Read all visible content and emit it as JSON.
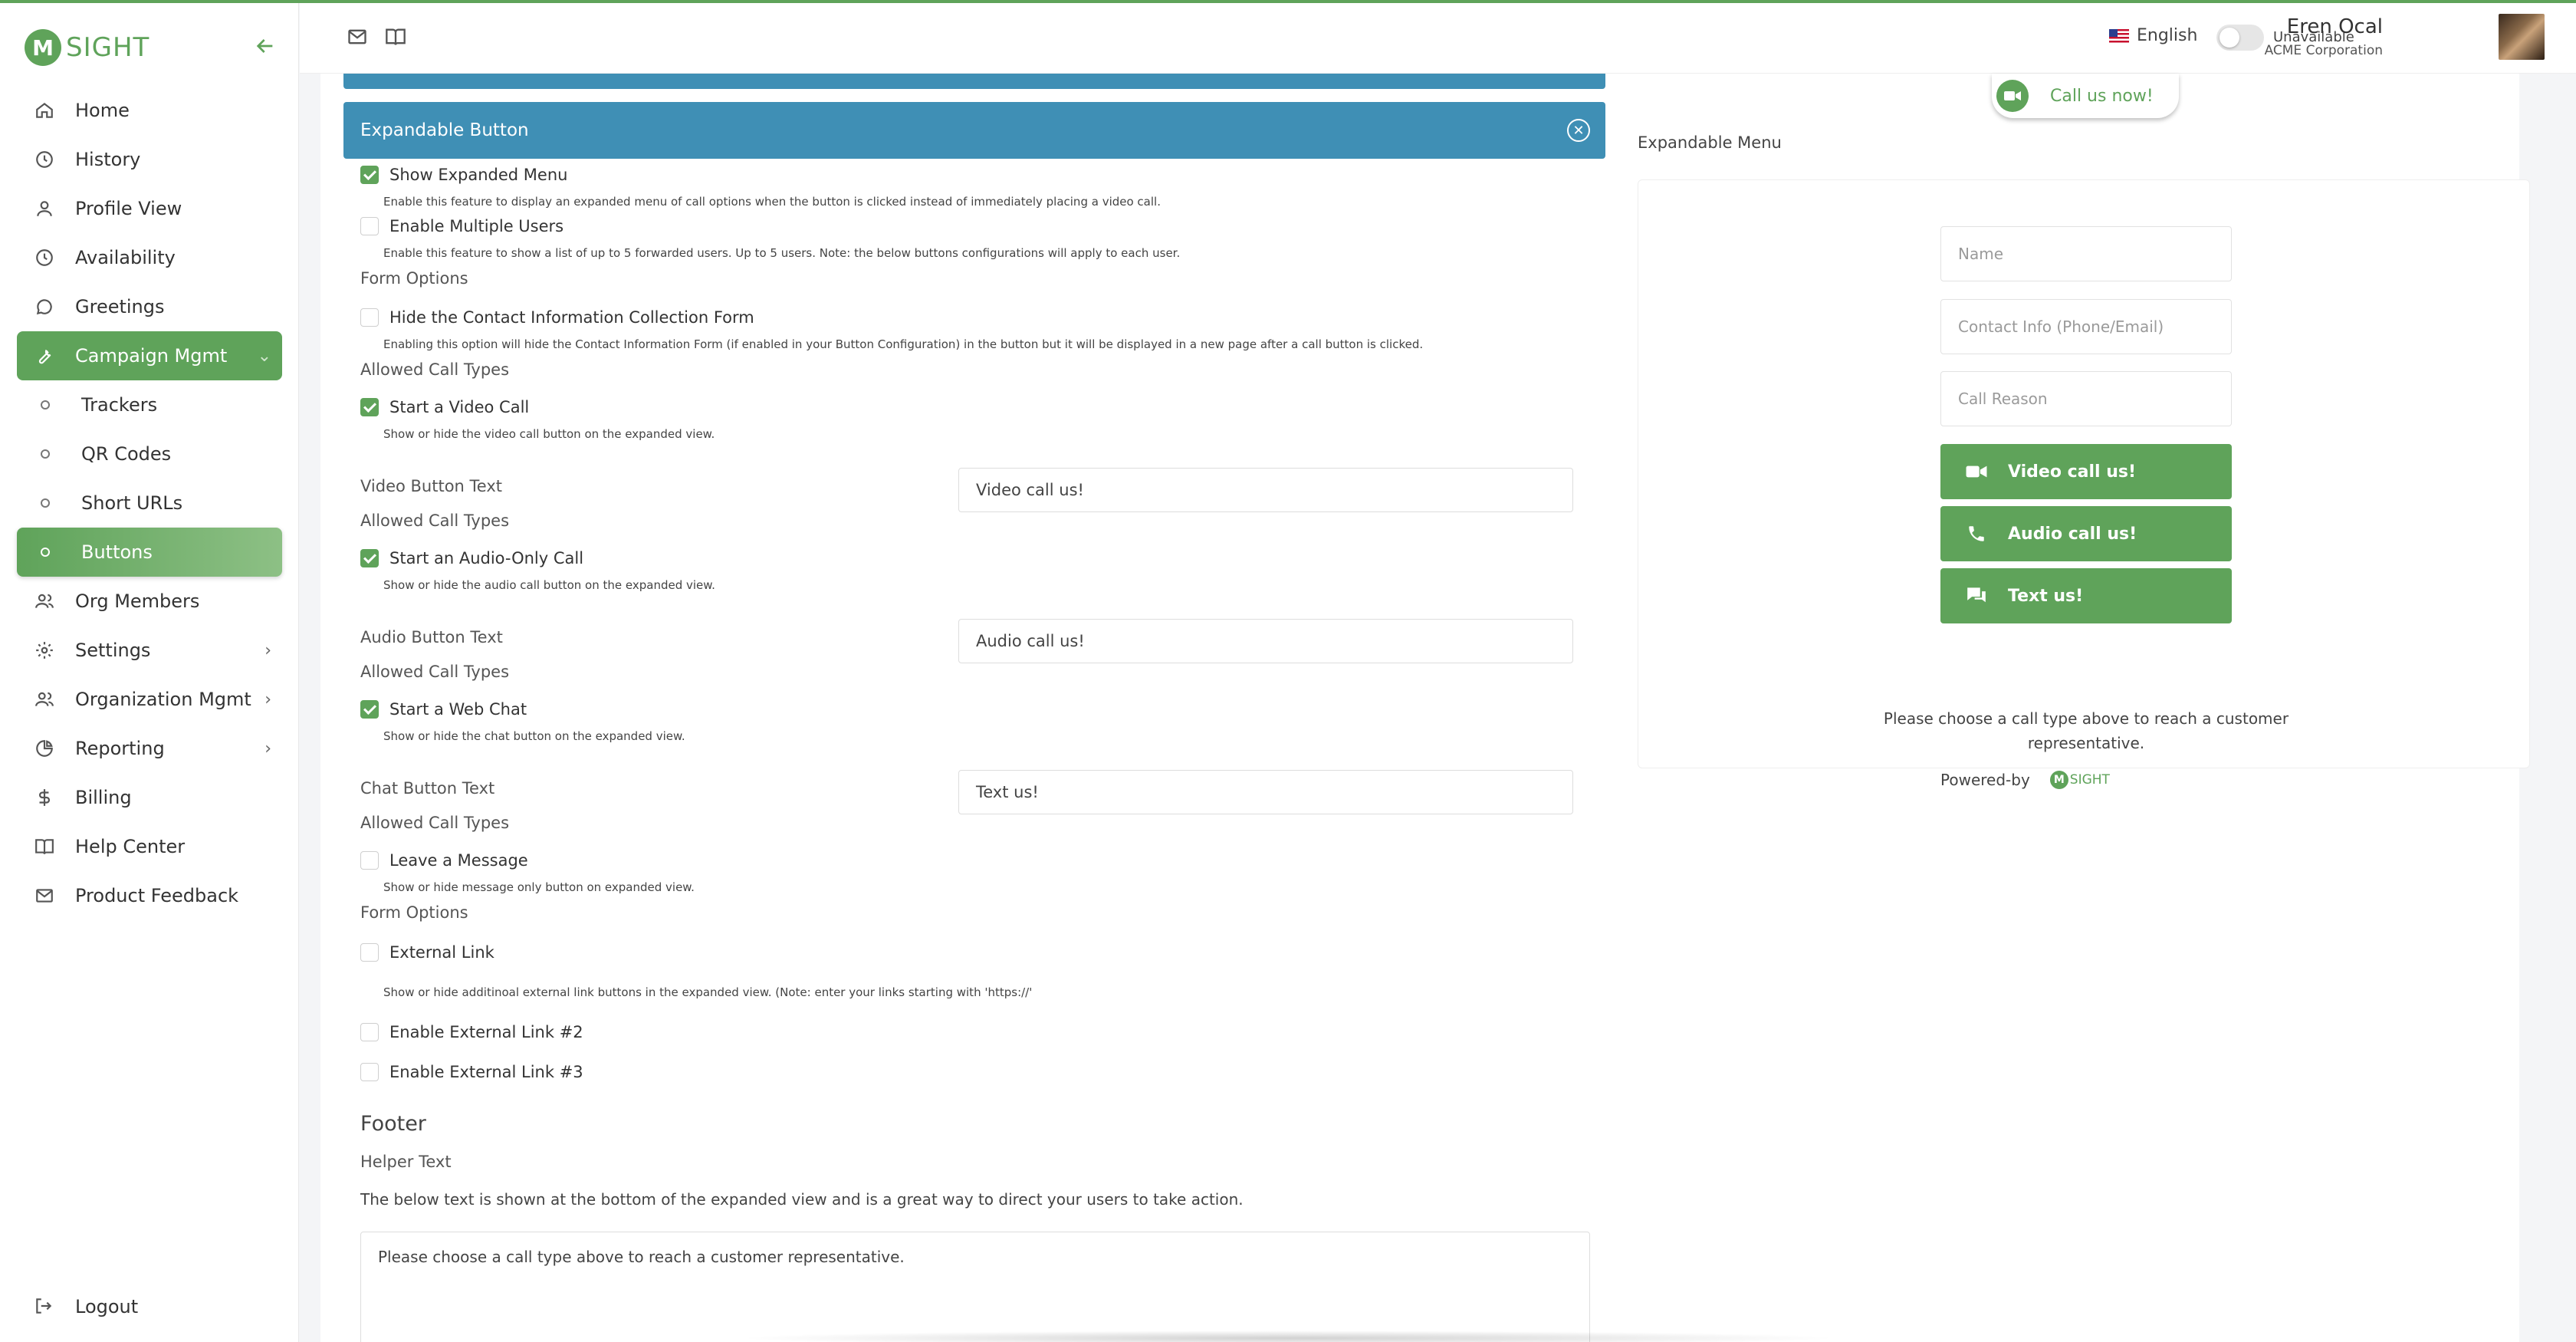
{
  "brand": {
    "logo_letter": "M",
    "logo_text": "SIGHT",
    "accent": "#5fa35a",
    "header_blue": "#3f8fb5"
  },
  "sidebar": {
    "items": [
      {
        "label": "Home",
        "icon": "home-icon"
      },
      {
        "label": "History",
        "icon": "clock-icon"
      },
      {
        "label": "Profile View",
        "icon": "user-icon"
      },
      {
        "label": "Availability",
        "icon": "clock-icon"
      },
      {
        "label": "Greetings",
        "icon": "chat-icon"
      },
      {
        "label": "Campaign Mgmt",
        "icon": "wrench-icon"
      },
      {
        "label": "Trackers",
        "icon": "circle-icon"
      },
      {
        "label": "QR Codes",
        "icon": "circle-icon"
      },
      {
        "label": "Short URLs",
        "icon": "circle-icon"
      },
      {
        "label": "Buttons",
        "icon": "circle-icon"
      },
      {
        "label": "Org Members",
        "icon": "users-icon"
      },
      {
        "label": "Settings",
        "icon": "gear-icon"
      },
      {
        "label": "Organization Mgmt",
        "icon": "users-icon"
      },
      {
        "label": "Reporting",
        "icon": "pie-chart-icon"
      },
      {
        "label": "Billing",
        "icon": "dollar-icon"
      },
      {
        "label": "Help Center",
        "icon": "book-icon"
      },
      {
        "label": "Product Feedback",
        "icon": "mail-icon"
      }
    ],
    "logout": "Logout"
  },
  "topbar": {
    "language": "English",
    "status": "Unavailable",
    "user_name": "Eren Ocal",
    "user_org": "ACME Corporation"
  },
  "form": {
    "panel_title": "Expandable Button",
    "show_expanded_menu": {
      "label": "Show Expanded Menu",
      "checked": true,
      "help": "Enable this feature to display an expanded menu of call options when the button is clicked instead of immediately placing a video call."
    },
    "enable_multiple_users": {
      "label": "Enable Multiple Users",
      "checked": false,
      "help": "Enable this feature to show a list of up to 5 forwarded users. Up to 5 users. Note: the below buttons configurations will apply to each user."
    },
    "form_options_1": "Form Options",
    "hide_contact_form": {
      "label": "Hide the Contact Information Collection Form",
      "checked": false,
      "help": "Enabling this option will hide the Contact Information Form (if enabled in your Button Configuration) in the button but it will be displayed in a new page after a call button is clicked."
    },
    "allowed_call_types_1": "Allowed Call Types",
    "video_call": {
      "label": "Start a Video Call",
      "checked": true,
      "help": "Show or hide the video call button on the expanded view."
    },
    "video_button_text_label": "Video Button Text",
    "video_button_text_value": "Video call us!",
    "allowed_call_types_2": "Allowed Call Types",
    "audio_call": {
      "label": "Start an Audio-Only Call",
      "checked": true,
      "help": "Show or hide the audio call button on the expanded view."
    },
    "audio_button_text_label": "Audio Button Text",
    "audio_button_text_value": "Audio call us!",
    "allowed_call_types_3": "Allowed Call Types",
    "web_chat": {
      "label": "Start a Web Chat",
      "checked": true,
      "help": "Show or hide the chat button on the expanded view."
    },
    "chat_button_text_label": "Chat Button Text",
    "chat_button_text_value": "Text us!",
    "allowed_call_types_4": "Allowed Call Types",
    "leave_message": {
      "label": "Leave a Message",
      "checked": false,
      "help": "Show or hide message only button on expanded view."
    },
    "form_options_2": "Form Options",
    "external_link": {
      "label": "External Link",
      "checked": false,
      "help": "Show or hide additinoal external link buttons in the expanded view. (Note: enter your links starting with 'https://'"
    },
    "external_link_2": {
      "label": "Enable External Link #2",
      "checked": false
    },
    "external_link_3": {
      "label": "Enable External Link #3",
      "checked": false
    },
    "footer_title": "Footer",
    "helper_text_label": "Helper Text",
    "helper_text_desc": "The below text is shown at the bottom of the expanded view and is a great way to direct your users to take action.",
    "helper_text_value": "Please choose a call type above to reach a customer representative."
  },
  "preview": {
    "call_now": "Call us now!",
    "section_label": "Expandable Menu",
    "name_placeholder": "Name",
    "contact_placeholder": "Contact Info (Phone/Email)",
    "reason_placeholder": "Call Reason",
    "video_btn": "Video call us!",
    "audio_btn": "Audio call us!",
    "text_btn": "Text us!",
    "helper": "Please choose a call type above to reach a customer representative.",
    "powered_by": "Powered-by",
    "mini_logo_letter": "M",
    "mini_logo_text": "SIGHT"
  }
}
